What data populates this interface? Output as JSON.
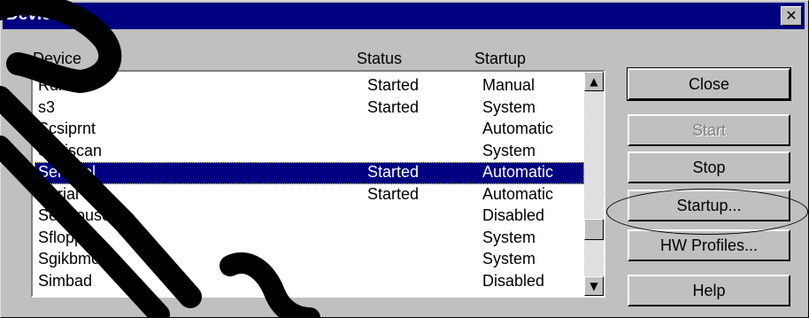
{
  "dialog": {
    "title": "Devices",
    "close_glyph": "✕"
  },
  "columns": {
    "device": "Device",
    "status": "Status",
    "startup": "Startup"
  },
  "devices": [
    {
      "device": "Rdr",
      "status": "Started",
      "startup": "Manual"
    },
    {
      "device": "s3",
      "status": "Started",
      "startup": "System"
    },
    {
      "device": "Scsiprnt",
      "status": "",
      "startup": "Automatic"
    },
    {
      "device": "Scsiscan",
      "status": "",
      "startup": "System"
    },
    {
      "device": "Sentinel",
      "status": "Started",
      "startup": "Automatic",
      "selected": true
    },
    {
      "device": "Serial",
      "status": "Started",
      "startup": "Automatic"
    },
    {
      "device": "Sermouse",
      "status": "",
      "startup": "Disabled"
    },
    {
      "device": "Sfloppy",
      "status": "",
      "startup": "System"
    },
    {
      "device": "Sgikbmou",
      "status": "",
      "startup": "System"
    },
    {
      "device": "Simbad",
      "status": "",
      "startup": "Disabled"
    }
  ],
  "buttons": {
    "close": "Close",
    "start": "Start",
    "stop": "Stop",
    "startup": "Startup...",
    "hw_profiles": "HW Profiles...",
    "help": "Help"
  },
  "scrollbar": {
    "up_icon": "arrow-up-icon",
    "down_icon": "arrow-down-icon"
  },
  "colors": {
    "titlebar": "#000080",
    "selection": "#000080",
    "face": "#c0c0c0",
    "watermark": "#000000"
  }
}
